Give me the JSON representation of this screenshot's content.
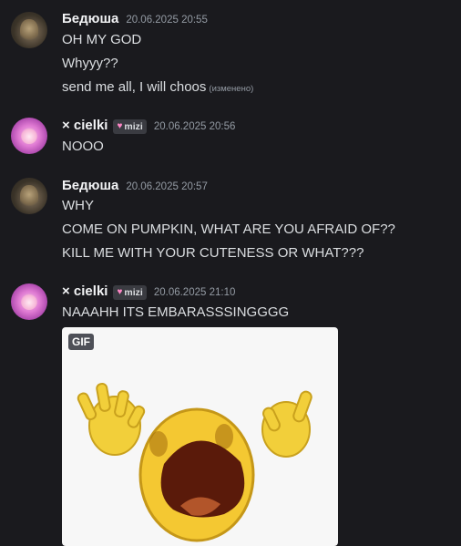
{
  "messages": [
    {
      "author": "Бедюша",
      "timestamp": "20.06.2025 20:55",
      "lines": [
        "OH MY GOD",
        "Whyyy??",
        "send me all, I will choos"
      ],
      "edited_label": "(изменено)"
    },
    {
      "author": "× cielki",
      "tag": "mizi",
      "timestamp": "20.06.2025 20:56",
      "lines": [
        "NOOO"
      ]
    },
    {
      "author": "Бедюша",
      "timestamp": "20.06.2025 20:57",
      "lines": [
        "WHY",
        "COME ON PUMPKIN, WHAT ARE YOU AFRAID OF??",
        "KILL ME WITH YOUR CUTENESS OR WHAT???"
      ]
    },
    {
      "author": "× cielki",
      "tag": "mizi",
      "timestamp": "20.06.2025 21:10",
      "lines": [
        "NAAAHH ITS EMBARASSSINGGGG"
      ],
      "attachment": {
        "badge": "GIF",
        "icon": "crying-emoji-gif"
      }
    }
  ],
  "colors": {
    "background": "#1a1a1e",
    "text": "#dbdee1",
    "muted": "#949ba4",
    "username": "#f2f3f5",
    "tag_background": "#3a3b41",
    "tag_heart": "#ff86c6"
  }
}
